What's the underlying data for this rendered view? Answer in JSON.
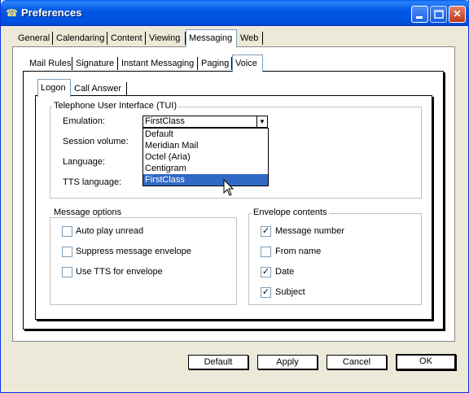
{
  "window": {
    "title": "Preferences",
    "app_icon": "phone-icon",
    "controls": [
      "minimize-icon",
      "maximize-icon",
      "close-icon"
    ]
  },
  "top_tabs": [
    "General",
    "Calendaring",
    "Content",
    "Viewing",
    "Messaging",
    "Web"
  ],
  "top_tabs_active": "Messaging",
  "sub_tabs": [
    "Mail Rules",
    "Signature",
    "Instant Messaging",
    "Paging",
    "Voice"
  ],
  "sub_tabs_active": "Voice",
  "inner_tabs": [
    "Logon",
    "Call Answer"
  ],
  "inner_tabs_active": "Logon",
  "tui": {
    "group_title": "Telephone User Interface (TUI)",
    "emulation_label": "Emulation:",
    "emulation_value": "FirstClass",
    "session_volume_label": "Session volume:",
    "language_label": "Language:",
    "tts_language_label": "TTS language:",
    "dropdown_options": [
      "Default",
      "Meridian Mail",
      "Octel (Aria)",
      "Centigram",
      "FirstClass"
    ],
    "dropdown_selected": "FirstClass"
  },
  "message_options": {
    "title": "Message options",
    "items": [
      {
        "label": "Auto play unread",
        "checked": false
      },
      {
        "label": "Suppress message envelope",
        "checked": false
      },
      {
        "label": "Use TTS for envelope",
        "checked": false
      }
    ]
  },
  "envelope_contents": {
    "title": "Envelope contents",
    "items": [
      {
        "label": "Message number",
        "checked": true
      },
      {
        "label": "From name",
        "checked": false
      },
      {
        "label": "Date",
        "checked": true
      },
      {
        "label": "Subject",
        "checked": true
      }
    ]
  },
  "buttons": {
    "default_label": "Default",
    "apply_label": "Apply",
    "cancel_label": "Cancel",
    "ok_label": "OK"
  },
  "colors": {
    "title_bar": "#0058e6",
    "selection": "#316ac5"
  }
}
